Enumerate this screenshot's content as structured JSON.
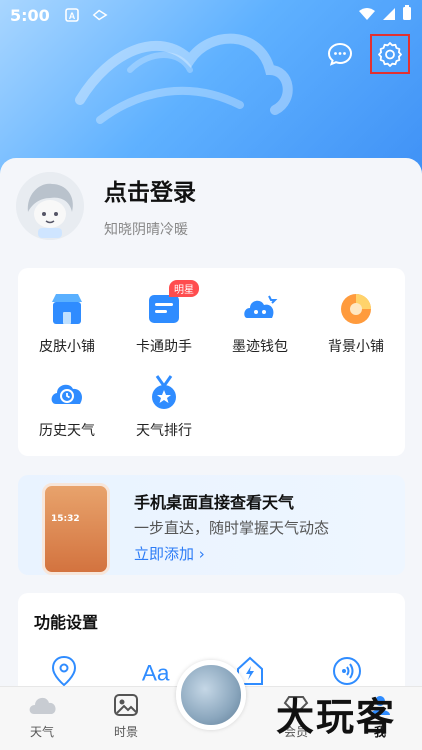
{
  "status_bar": {
    "time": "5:00"
  },
  "profile": {
    "title": "点击登录",
    "subtitle": "知晓阴晴冷暖"
  },
  "grid": {
    "items": [
      {
        "label": "皮肤小铺",
        "icon": "shop-icon"
      },
      {
        "label": "卡通助手",
        "icon": "cartoon-assistant-icon",
        "badge": "明星"
      },
      {
        "label": "墨迹钱包",
        "icon": "wallet-icon"
      },
      {
        "label": "背景小铺",
        "icon": "background-shop-icon"
      },
      {
        "label": "历史天气",
        "icon": "history-weather-icon"
      },
      {
        "label": "天气排行",
        "icon": "weather-ranking-icon"
      }
    ]
  },
  "promo": {
    "title": "手机桌面直接查看天气",
    "subtitle": "一步直达，随时掌握天气动态",
    "link": "立即添加 ›",
    "phone_time": "15:32"
  },
  "function_settings": {
    "title": "功能设置"
  },
  "bottom_nav": {
    "items": [
      {
        "label": "天气"
      },
      {
        "label": "时景"
      },
      {
        "label": "会员"
      },
      {
        "label": "我",
        "active": true
      }
    ]
  },
  "watermark": "大玩客",
  "colors": {
    "accent": "#2d7cf6",
    "badge": "#ff4d4f",
    "highlight_border": "#e23131"
  }
}
